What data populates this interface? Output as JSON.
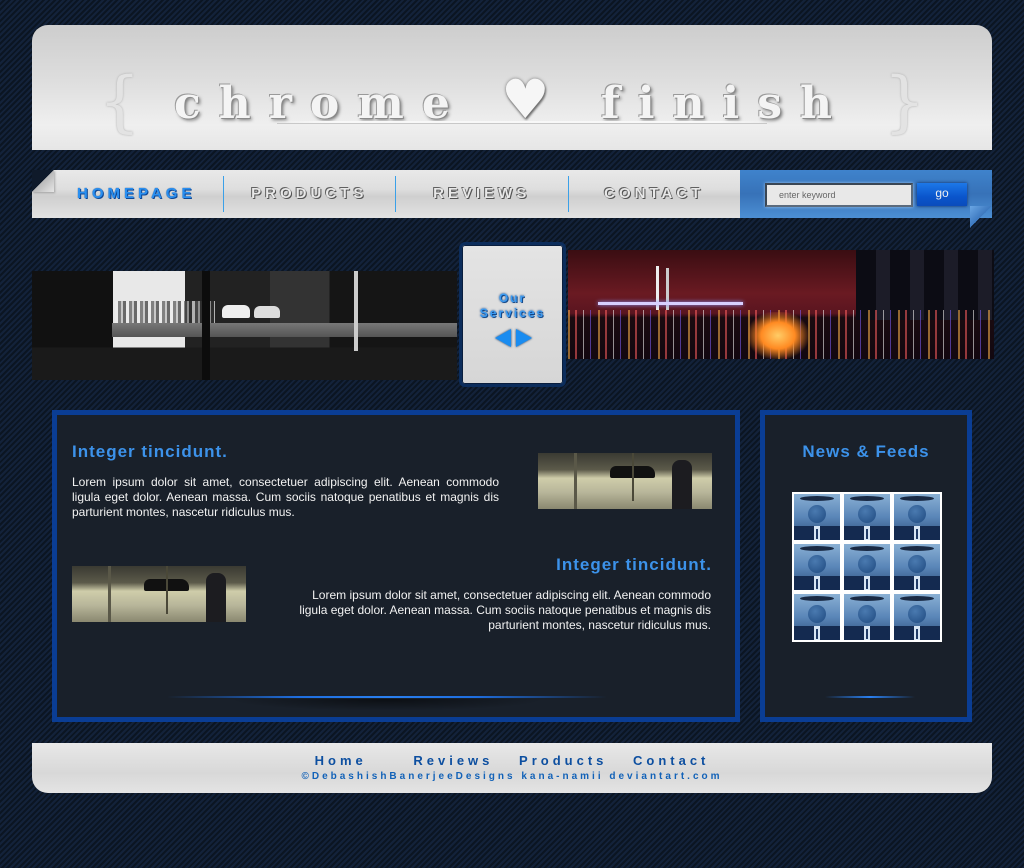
{
  "header": {
    "logo_left_brace": "{",
    "logo_word1": "chrome",
    "logo_heart": "♥",
    "logo_word2": "finish",
    "logo_right_brace": "}"
  },
  "nav": {
    "items": [
      {
        "label": "HOMEPAGE",
        "active": true
      },
      {
        "label": "PRODUCTS",
        "active": false
      },
      {
        "label": "REVIEWS",
        "active": false
      },
      {
        "label": "CONTACT",
        "active": false
      }
    ]
  },
  "search": {
    "placeholder": "enter keyword",
    "value": "",
    "button_label": "go"
  },
  "banner": {
    "services_title_line1": "Our",
    "services_title_line2": "Services",
    "prev_icon": "arrow-left-icon",
    "next_icon": "arrow-right-icon"
  },
  "content": {
    "articles": [
      {
        "heading": "Integer tincidunt.",
        "body": "Lorem ipsum dolor sit amet, consectetuer adipiscing elit. Aenean commodo ligula eget dolor. Aenean massa. Cum sociis natoque penatibus et magnis dis parturient montes, nascetur ridiculus mus."
      },
      {
        "heading": "Integer tincidunt.",
        "body": "Lorem ipsum dolor sit amet, consectetuer adipiscing elit. Aenean commodo ligula eget dolor. Aenean massa. Cum sociis natoque penatibus et magnis dis parturient montes, nascetur ridiculus mus."
      }
    ]
  },
  "news": {
    "title": "News & Feeds",
    "thumbnail_count": 9
  },
  "footer": {
    "links": [
      "Home",
      "Reviews",
      "Products",
      "Contact"
    ],
    "credit": "©DebashishBanerjeeDesigns kana-namii deviantart.com"
  },
  "colors": {
    "accent_blue": "#3c92ea",
    "border_blue": "#0a3d94",
    "panel_bg": "#19202a",
    "chrome_light": "#e6e6e6"
  }
}
